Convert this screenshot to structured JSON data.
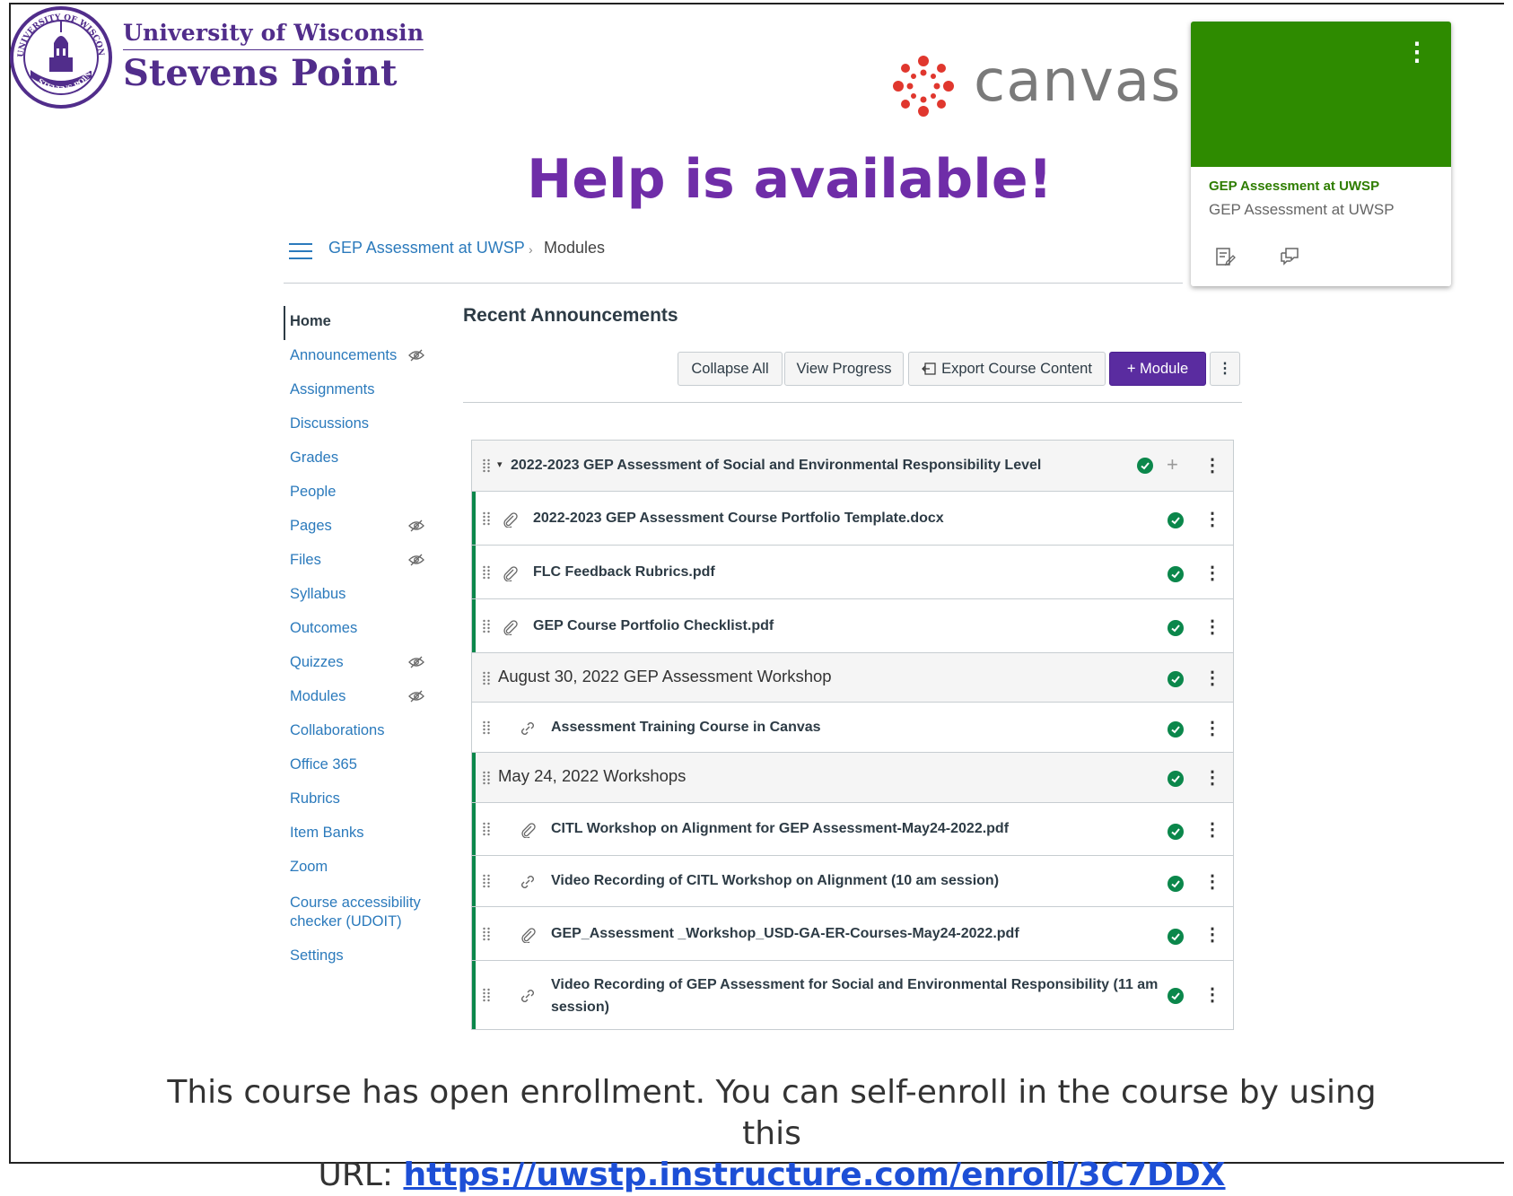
{
  "branding": {
    "university_line1": "University of Wisconsin",
    "university_line2": "Stevens Point",
    "seal_text_top": "UNIVERSITY OF WISCONSIN",
    "seal_text_bottom": "STEVENS POINT",
    "canvas_word": "canvas"
  },
  "headline": "Help is available!",
  "card": {
    "title": "GEP Assessment at UWSP",
    "subtitle": "GEP Assessment at UWSP",
    "header_color": "#2e8b00"
  },
  "breadcrumb": {
    "course": "GEP Assessment at UWSP",
    "separator": "›",
    "current": "Modules"
  },
  "nav": [
    {
      "label": "Home",
      "active": true,
      "hidden": false
    },
    {
      "label": "Announcements",
      "hidden": true
    },
    {
      "label": "Assignments",
      "hidden": false
    },
    {
      "label": "Discussions",
      "hidden": false
    },
    {
      "label": "Grades",
      "hidden": false
    },
    {
      "label": "People",
      "hidden": false
    },
    {
      "label": "Pages",
      "hidden": true
    },
    {
      "label": "Files",
      "hidden": true
    },
    {
      "label": "Syllabus",
      "hidden": false
    },
    {
      "label": "Outcomes",
      "hidden": false
    },
    {
      "label": "Quizzes",
      "hidden": true
    },
    {
      "label": "Modules",
      "hidden": true
    },
    {
      "label": "Collaborations",
      "hidden": false
    },
    {
      "label": "Office 365",
      "hidden": false
    },
    {
      "label": "Rubrics",
      "hidden": false
    },
    {
      "label": "Item Banks",
      "hidden": false
    },
    {
      "label": "Zoom",
      "hidden": false
    },
    {
      "label": "Course accessibility checker (UDOIT)",
      "label_line1": "Course accessibility",
      "label_line2": "checker (UDOIT)",
      "hidden": false
    },
    {
      "label": "Settings",
      "hidden": false
    }
  ],
  "main": {
    "recent_heading": "Recent Announcements",
    "buttons": {
      "collapse": "Collapse All",
      "progress": "View Progress",
      "export": "Export Course Content",
      "module": "+ Module"
    }
  },
  "modules": [
    {
      "kind": "module",
      "title": "2022-2023 GEP Assessment of Social and Environmental Responsibility Level",
      "collapsible": true
    },
    {
      "kind": "file",
      "title": "2022-2023 GEP Assessment Course Portfolio Template.docx"
    },
    {
      "kind": "file",
      "title": "FLC Feedback Rubrics.pdf"
    },
    {
      "kind": "file",
      "title": "GEP Course Portfolio Checklist.pdf"
    },
    {
      "kind": "module",
      "title": "August 30, 2022 GEP Assessment Workshop"
    },
    {
      "kind": "link",
      "title": "Assessment Training Course in Canvas"
    },
    {
      "kind": "module",
      "title": "May 24, 2022 Workshops"
    },
    {
      "kind": "file",
      "title": "CITL Workshop on Alignment for GEP Assessment-May24-2022.pdf"
    },
    {
      "kind": "link",
      "title": "Video Recording of CITL Workshop on Alignment (10 am session)"
    },
    {
      "kind": "file",
      "title": "GEP_Assessment _Workshop_USD-GA-ER-Courses-May24-2022.pdf"
    },
    {
      "kind": "link",
      "title": "Video Recording of GEP Assessment for Social and Environmental Responsibility (11 am session)",
      "title_line1": "Video Recording of GEP Assessment for Social and Environmental Responsibility (11 am",
      "title_line2": "session)"
    }
  ],
  "footer": {
    "text_line1": "This course has open enrollment. You can self-enroll in the course by using this",
    "url_prefix": "URL: ",
    "url": "https://uwstp.instructure.com/enroll/3C7DDX"
  },
  "colors": {
    "brand_purple": "#512d8b",
    "headline_purple": "#6f2da8",
    "link_blue": "#2b7abc",
    "published_green": "#0b874b",
    "module_button": "#5a2ca0"
  }
}
